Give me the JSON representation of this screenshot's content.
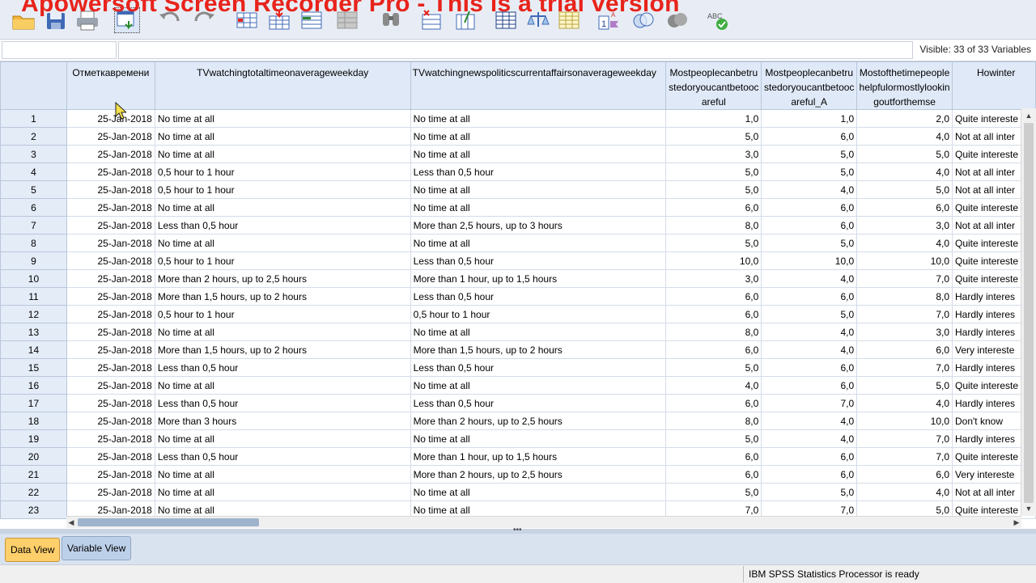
{
  "watermark": "Apowersoft Screen Recorder Pro - This is a trial version",
  "toolbar": {
    "icons": [
      "open-folder-icon",
      "save-icon",
      "print-icon",
      "dialog-recall-icon",
      "undo-icon",
      "redo-icon",
      "goto-case-icon",
      "goto-variable-icon",
      "variables-icon",
      "run-descriptives-icon",
      "find-icon",
      "insert-cases-icon",
      "insert-variable-icon",
      "split-file-icon",
      "weight-cases-icon",
      "select-cases-icon",
      "value-labels-icon",
      "use-sets-icon",
      "show-all-variables-icon",
      "spell-check-icon"
    ]
  },
  "editbar": {
    "cell_ref": "",
    "cell_value": "",
    "visible_label": "Visible: 33 of 33 Variables"
  },
  "grid": {
    "columns": [
      "Отметкавремени",
      "TVwatchingtotaltimeonaverageweekday",
      "TVwatchingnewspoliticscurrentaffairsonaverageweekday",
      "Mostpeoplecanbetrustedoryoucantbetoocareful",
      "Mostpeoplecanbetrustedoryoucantbetoocareful_A",
      "Mostofthetimepeoplehelpfulormostlylookingoutforthemse",
      "Howinter"
    ],
    "rows": [
      [
        "1",
        "25-Jan-2018",
        "No time at all",
        "No time at all",
        "1,0",
        "1,0",
        "2,0",
        "Quite intereste"
      ],
      [
        "2",
        "25-Jan-2018",
        "No time at all",
        "No time at all",
        "5,0",
        "6,0",
        "4,0",
        "Not at all inter"
      ],
      [
        "3",
        "25-Jan-2018",
        "No time at all",
        "No time at all",
        "3,0",
        "5,0",
        "5,0",
        "Quite intereste"
      ],
      [
        "4",
        "25-Jan-2018",
        "0,5 hour to 1 hour",
        "Less than 0,5 hour",
        "5,0",
        "5,0",
        "4,0",
        "Not at all inter"
      ],
      [
        "5",
        "25-Jan-2018",
        "0,5 hour to 1 hour",
        "No time at all",
        "5,0",
        "4,0",
        "5,0",
        "Not at all inter"
      ],
      [
        "6",
        "25-Jan-2018",
        "No time at all",
        "No time at all",
        "6,0",
        "6,0",
        "6,0",
        "Quite intereste"
      ],
      [
        "7",
        "25-Jan-2018",
        "Less than 0,5 hour",
        "More than 2,5 hours, up to 3 hours",
        "8,0",
        "6,0",
        "3,0",
        "Not at all inter"
      ],
      [
        "8",
        "25-Jan-2018",
        "No time at all",
        "No time at all",
        "5,0",
        "5,0",
        "4,0",
        "Quite intereste"
      ],
      [
        "9",
        "25-Jan-2018",
        "0,5 hour to 1 hour",
        "Less than 0,5 hour",
        "10,0",
        "10,0",
        "10,0",
        "Quite intereste"
      ],
      [
        "10",
        "25-Jan-2018",
        "More than 2 hours, up to 2,5 hours",
        "More than 1 hour, up to 1,5 hours",
        "3,0",
        "4,0",
        "7,0",
        "Quite intereste"
      ],
      [
        "11",
        "25-Jan-2018",
        "More than 1,5 hours, up to 2 hours",
        "Less than 0,5 hour",
        "6,0",
        "6,0",
        "8,0",
        "Hardly interes"
      ],
      [
        "12",
        "25-Jan-2018",
        "0,5 hour to 1 hour",
        "0,5 hour to 1 hour",
        "6,0",
        "5,0",
        "7,0",
        "Hardly interes"
      ],
      [
        "13",
        "25-Jan-2018",
        "No time at all",
        "No time at all",
        "8,0",
        "4,0",
        "3,0",
        "Hardly interes"
      ],
      [
        "14",
        "25-Jan-2018",
        "More than 1,5 hours, up to 2 hours",
        "More than 1,5 hours, up to 2 hours",
        "6,0",
        "4,0",
        "6,0",
        "Very intereste"
      ],
      [
        "15",
        "25-Jan-2018",
        "Less than 0,5 hour",
        "Less than 0,5 hour",
        "5,0",
        "6,0",
        "7,0",
        "Hardly interes"
      ],
      [
        "16",
        "25-Jan-2018",
        "No time at all",
        "No time at all",
        "4,0",
        "6,0",
        "5,0",
        "Quite intereste"
      ],
      [
        "17",
        "25-Jan-2018",
        "Less than 0,5 hour",
        "Less than 0,5 hour",
        "6,0",
        "7,0",
        "4,0",
        "Hardly interes"
      ],
      [
        "18",
        "25-Jan-2018",
        "More than 3 hours",
        "More than 2 hours, up to 2,5 hours",
        "8,0",
        "4,0",
        "10,0",
        "Don't know"
      ],
      [
        "19",
        "25-Jan-2018",
        "No time at all",
        "No time at all",
        "5,0",
        "4,0",
        "7,0",
        "Hardly interes"
      ],
      [
        "20",
        "25-Jan-2018",
        "Less than 0,5 hour",
        "More than 1 hour, up to 1,5 hours",
        "6,0",
        "6,0",
        "7,0",
        "Quite intereste"
      ],
      [
        "21",
        "25-Jan-2018",
        "No time at all",
        "More than 2 hours, up to 2,5 hours",
        "6,0",
        "6,0",
        "6,0",
        "Very intereste"
      ],
      [
        "22",
        "25-Jan-2018",
        "No time at all",
        "No time at all",
        "5,0",
        "5,0",
        "4,0",
        "Not at all inter"
      ],
      [
        "23",
        "25-Jan-2018",
        "No time at all",
        "No time at all",
        "7,0",
        "7,0",
        "5,0",
        "Quite intereste"
      ]
    ]
  },
  "tabs": {
    "data_view": "Data View",
    "variable_view": "Variable View"
  },
  "status": {
    "message": "IBM SPSS Statistics Processor is ready"
  },
  "colors": {
    "accent_tab": "#ffcf6b",
    "header_bg": "#dfe9f7",
    "watermark": "#e8231b"
  }
}
